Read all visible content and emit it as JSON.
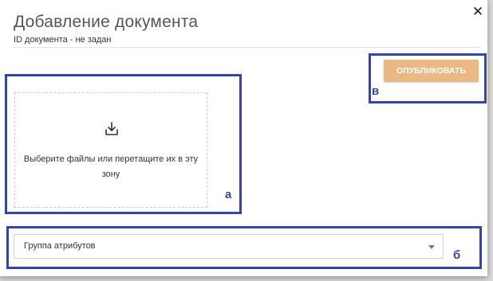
{
  "dialog": {
    "title": "Добавление документа",
    "subtitle": "ID документа - не задан",
    "close_icon": "close-icon",
    "close_glyph": "✕"
  },
  "toolbar": {
    "publish_label": "ОПУБЛИКОВАТЬ"
  },
  "upload": {
    "icon": "upload-icon",
    "text": "Выберите файлы или перетащите их в эту зону"
  },
  "attributes": {
    "select_label": "Группа атрибутов",
    "arrow_icon": "caret-down-icon"
  },
  "annotations": {
    "a": "а",
    "b": "б",
    "v": "в"
  },
  "colors": {
    "accent_button": "#e9b883",
    "annotation_frame": "#3344aa"
  }
}
